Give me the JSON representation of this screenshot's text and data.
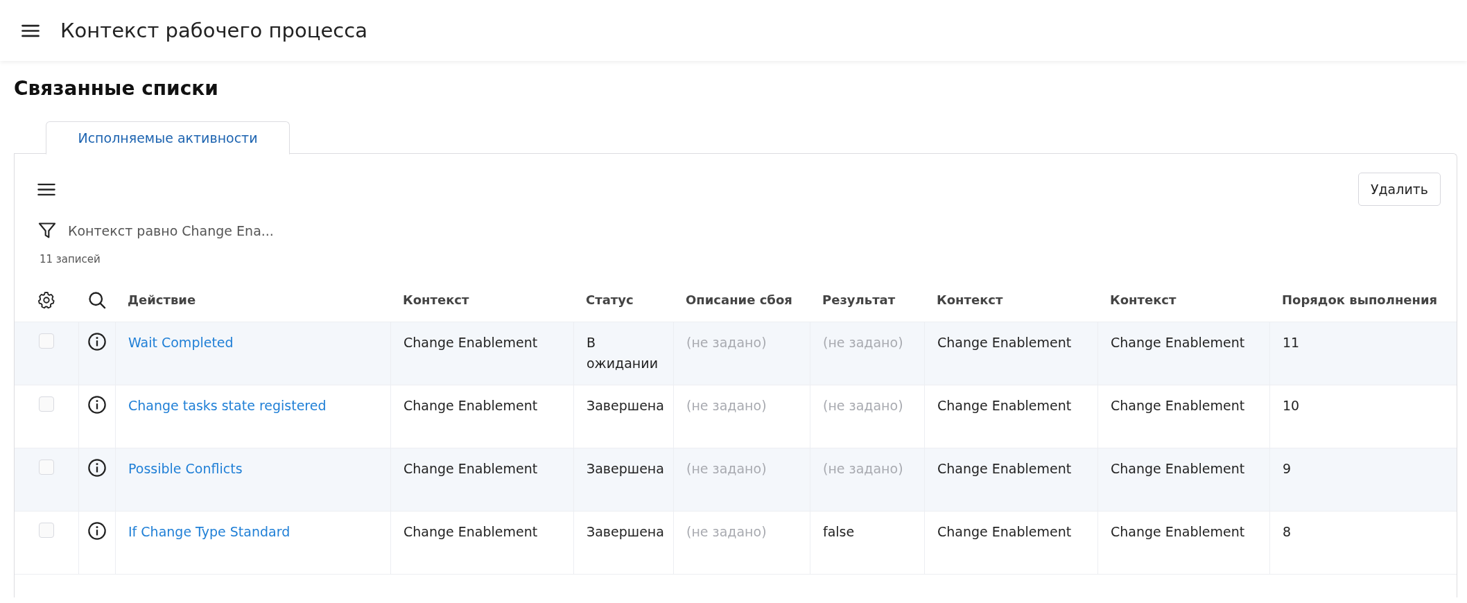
{
  "header": {
    "title": "Контекст рабочего процесса"
  },
  "section_title": "Связанные списки",
  "tabs": [
    {
      "label": "Исполняемые активности",
      "selected": true
    }
  ],
  "toolbar": {
    "delete_button": "Удалить"
  },
  "filter": {
    "text": "Контекст равно Change Ena..."
  },
  "record_count": "11 записей",
  "table": {
    "columns": [
      "Действие",
      "Контекст",
      "Статус",
      "Описание сбоя",
      "Результат",
      "Контекст",
      "Контекст",
      "Порядок выполнения"
    ],
    "rows": [
      {
        "checked": false,
        "cells": [
          {
            "text": "Wait Completed",
            "kind": "link"
          },
          {
            "text": "Change Enablement",
            "kind": "text"
          },
          {
            "text": "В ожидании",
            "kind": "text"
          },
          {
            "text": "(не задано)",
            "kind": "unset"
          },
          {
            "text": "(не задано)",
            "kind": "unset"
          },
          {
            "text": "Change Enablement",
            "kind": "text"
          },
          {
            "text": "Change Enablement",
            "kind": "text"
          },
          {
            "text": "11",
            "kind": "text"
          }
        ]
      },
      {
        "checked": false,
        "cells": [
          {
            "text": "Change tasks state registered",
            "kind": "link"
          },
          {
            "text": "Change Enablement",
            "kind": "text"
          },
          {
            "text": "Завершена",
            "kind": "text"
          },
          {
            "text": "(не задано)",
            "kind": "unset"
          },
          {
            "text": "(не задано)",
            "kind": "unset"
          },
          {
            "text": "Change Enablement",
            "kind": "text"
          },
          {
            "text": "Change Enablement",
            "kind": "text"
          },
          {
            "text": "10",
            "kind": "text"
          }
        ]
      },
      {
        "checked": false,
        "cells": [
          {
            "text": "Possible Conflicts",
            "kind": "link"
          },
          {
            "text": "Change Enablement",
            "kind": "text"
          },
          {
            "text": "Завершена",
            "kind": "text"
          },
          {
            "text": "(не задано)",
            "kind": "unset"
          },
          {
            "text": "(не задано)",
            "kind": "unset"
          },
          {
            "text": "Change Enablement",
            "kind": "text"
          },
          {
            "text": "Change Enablement",
            "kind": "text"
          },
          {
            "text": "9",
            "kind": "text"
          }
        ]
      },
      {
        "checked": false,
        "cells": [
          {
            "text": "If Change Type Standard",
            "kind": "link"
          },
          {
            "text": "Change Enablement",
            "kind": "text"
          },
          {
            "text": "Завершена",
            "kind": "text"
          },
          {
            "text": "(не задано)",
            "kind": "unset"
          },
          {
            "text": "false",
            "kind": "text"
          },
          {
            "text": "Change Enablement",
            "kind": "text"
          },
          {
            "text": "Change Enablement",
            "kind": "text"
          },
          {
            "text": "8",
            "kind": "text"
          }
        ]
      }
    ]
  }
}
